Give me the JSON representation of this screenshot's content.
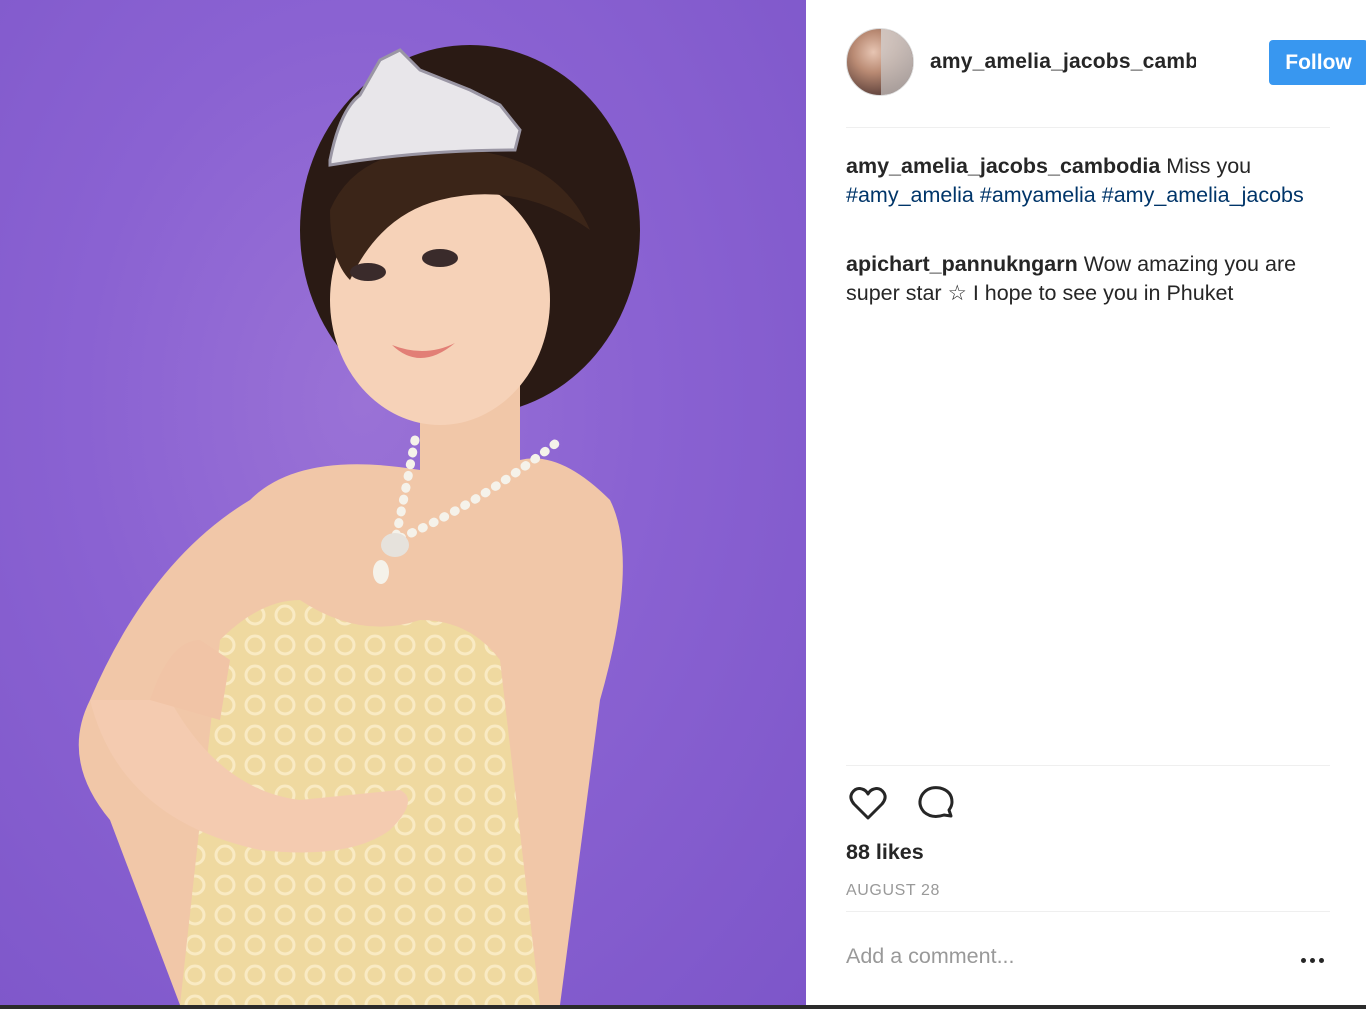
{
  "post": {
    "author": "amy_amelia_jacobs_camb",
    "follow_label": "Follow",
    "caption": {
      "author": "amy_amelia_jacobs_cambodia",
      "text": "Miss you",
      "tags": [
        "#amy_amelia",
        "#amyamelia",
        "#amy_amelia_jacobs"
      ]
    },
    "comments": [
      {
        "author": "apichart_pannukngarn",
        "text": "Wow amazing you are super star ☆ I hope to see you in Phuket"
      }
    ],
    "likes": "88 likes",
    "date": "AUGUST 28",
    "add_comment_placeholder": "Add a comment...",
    "icons": {
      "like": "heart-icon",
      "comment": "comment-bubble-icon",
      "more": "more-options-icon"
    }
  },
  "colors": {
    "photo_background": "#8a62d2",
    "follow_button": "#3897f0",
    "hashtag": "#003569",
    "muted_text": "#999999"
  }
}
